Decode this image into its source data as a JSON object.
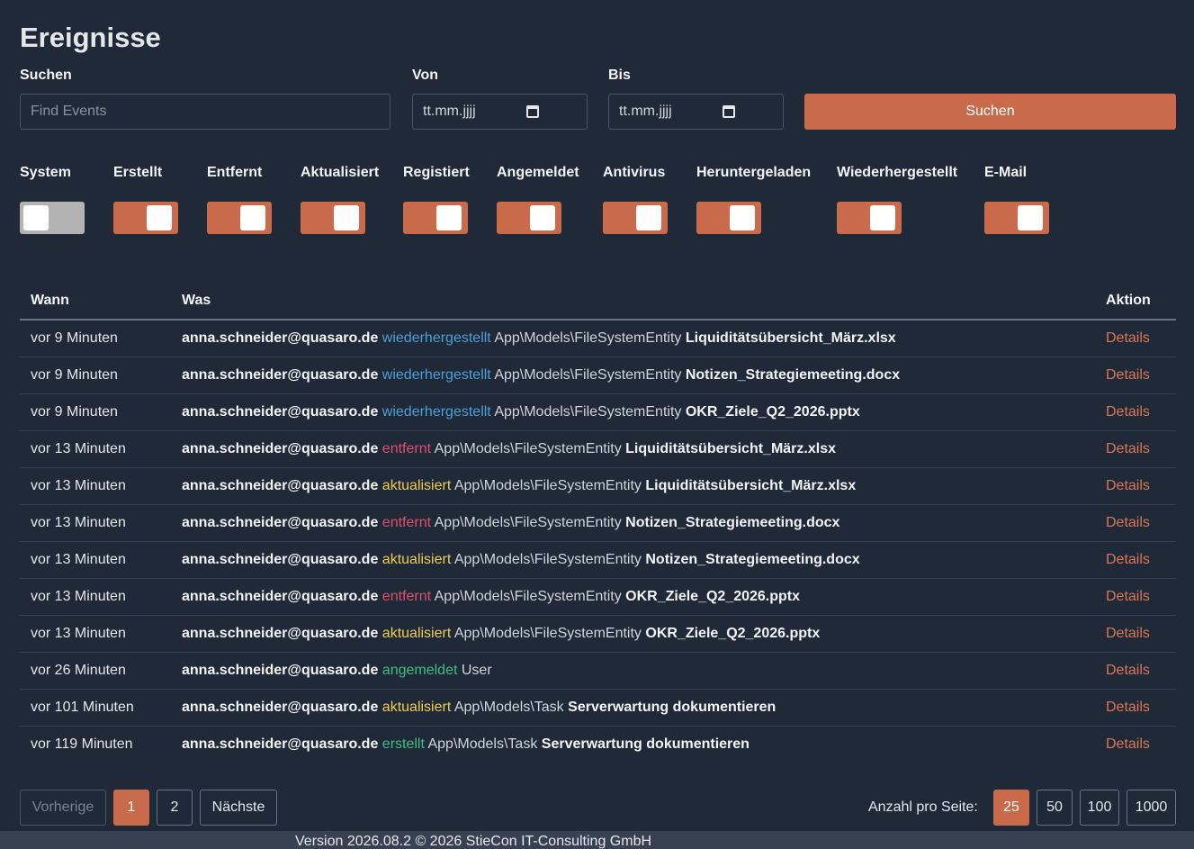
{
  "header": {
    "title": "Ereignisse"
  },
  "filters": {
    "search_label": "Suchen",
    "search_placeholder": "Find Events",
    "from_label": "Von",
    "from_value": "tt.mm.jjjj",
    "to_label": "Bis",
    "to_value": "tt.mm.jjjj",
    "search_button": "Suchen"
  },
  "toggles": [
    {
      "label": "System",
      "on": false
    },
    {
      "label": "Erstellt",
      "on": true
    },
    {
      "label": "Entfernt",
      "on": true
    },
    {
      "label": "Aktualisiert",
      "on": true
    },
    {
      "label": "Registiert",
      "on": true
    },
    {
      "label": "Angemeldet",
      "on": true
    },
    {
      "label": "Antivirus",
      "on": true
    },
    {
      "label": "Heruntergeladen",
      "on": true
    },
    {
      "label": "Wiederhergestellt",
      "on": true
    },
    {
      "label": "E-Mail",
      "on": true
    }
  ],
  "toggle_on_color": "#c96a4b",
  "toggle_off_color": "#b3b3b3",
  "table": {
    "headers": {
      "when": "Wann",
      "what": "Was",
      "action": "Aktion"
    },
    "rows": [
      {
        "when": "vor 9 Minuten",
        "user": "anna.schneider@quasaro.de",
        "action": "wiederhergestellt",
        "model": "App\\Models\\FileSystemEntity",
        "entity": "Liquiditätsübersicht_März.xlsx",
        "link": "Details"
      },
      {
        "when": "vor 9 Minuten",
        "user": "anna.schneider@quasaro.de",
        "action": "wiederhergestellt",
        "model": "App\\Models\\FileSystemEntity",
        "entity": "Notizen_Strategiemeeting.docx",
        "link": "Details"
      },
      {
        "when": "vor 9 Minuten",
        "user": "anna.schneider@quasaro.de",
        "action": "wiederhergestellt",
        "model": "App\\Models\\FileSystemEntity",
        "entity": "OKR_Ziele_Q2_2026.pptx",
        "link": "Details"
      },
      {
        "when": "vor 13 Minuten",
        "user": "anna.schneider@quasaro.de",
        "action": "entfernt",
        "model": "App\\Models\\FileSystemEntity",
        "entity": "Liquiditätsübersicht_März.xlsx",
        "link": "Details"
      },
      {
        "when": "vor 13 Minuten",
        "user": "anna.schneider@quasaro.de",
        "action": "aktualisiert",
        "model": "App\\Models\\FileSystemEntity",
        "entity": "Liquiditätsübersicht_März.xlsx",
        "link": "Details"
      },
      {
        "when": "vor 13 Minuten",
        "user": "anna.schneider@quasaro.de",
        "action": "entfernt",
        "model": "App\\Models\\FileSystemEntity",
        "entity": "Notizen_Strategiemeeting.docx",
        "link": "Details"
      },
      {
        "when": "vor 13 Minuten",
        "user": "anna.schneider@quasaro.de",
        "action": "aktualisiert",
        "model": "App\\Models\\FileSystemEntity",
        "entity": "Notizen_Strategiemeeting.docx",
        "link": "Details"
      },
      {
        "when": "vor 13 Minuten",
        "user": "anna.schneider@quasaro.de",
        "action": "entfernt",
        "model": "App\\Models\\FileSystemEntity",
        "entity": "OKR_Ziele_Q2_2026.pptx",
        "link": "Details"
      },
      {
        "when": "vor 13 Minuten",
        "user": "anna.schneider@quasaro.de",
        "action": "aktualisiert",
        "model": "App\\Models\\FileSystemEntity",
        "entity": "OKR_Ziele_Q2_2026.pptx",
        "link": "Details"
      },
      {
        "when": "vor 26 Minuten",
        "user": "anna.schneider@quasaro.de",
        "action": "angemeldet",
        "model": "User",
        "entity": "",
        "link": "Details"
      },
      {
        "when": "vor 101 Minuten",
        "user": "anna.schneider@quasaro.de",
        "action": "aktualisiert",
        "model": "App\\Models\\Task",
        "entity": "Serverwartung dokumentieren",
        "link": "Details"
      },
      {
        "when": "vor 119 Minuten",
        "user": "anna.schneider@quasaro.de",
        "action": "erstellt",
        "model": "App\\Models\\Task",
        "entity": "Serverwartung dokumentieren",
        "link": "Details"
      }
    ]
  },
  "pagination": {
    "prev": "Vorherige",
    "pages": [
      "1",
      "2"
    ],
    "current": "1",
    "next": "Nächste",
    "per_page_label": "Anzahl pro Seite:",
    "per_page_options": [
      "25",
      "50",
      "100",
      "1000"
    ],
    "per_page_current": "25"
  },
  "footer": {
    "text": "Version 2026.08.2 © 2026 StieCon IT-Consulting GmbH"
  }
}
